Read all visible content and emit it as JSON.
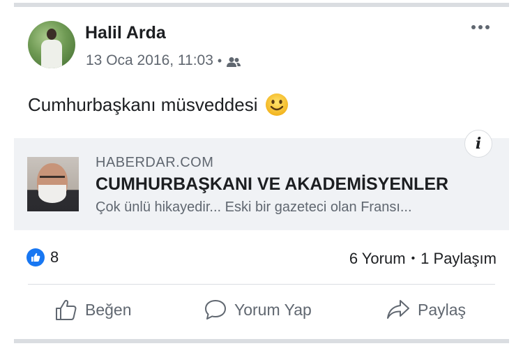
{
  "post": {
    "author": "Halil Arda",
    "timestamp": "13 Oca 2016, 11:03",
    "separator": "•",
    "privacy_icon": "friends-icon",
    "text": "Cumhurbaşkanı müsveddesi",
    "emoji": "smiley-emoji"
  },
  "link": {
    "domain": "HABERDAR.COM",
    "title": "CUMHURBAŞKANI VE AKADEMİSYENLER",
    "description": "Çok ünlü hikayedir...  Eski bir gazeteci olan Fransı...",
    "info_label": "i"
  },
  "engagement": {
    "reaction_count": "8",
    "comments": "6 Yorum",
    "dot": "•",
    "shares": "1 Paylaşım"
  },
  "actions": {
    "like": "Beğen",
    "comment": "Yorum Yap",
    "share": "Paylaş"
  },
  "colors": {
    "accent": "#1877f2",
    "secondary_text": "#606770",
    "card_background": "#f0f2f5"
  }
}
